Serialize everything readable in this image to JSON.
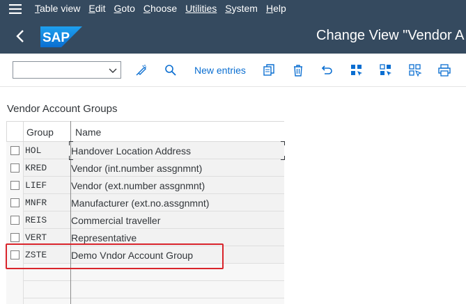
{
  "menu": {
    "items": [
      {
        "label": "Table view",
        "underline": "T",
        "rest": "able view"
      },
      {
        "label": "Edit",
        "underline": "E",
        "rest": "dit"
      },
      {
        "label": "Goto",
        "underline": "G",
        "rest": "oto"
      },
      {
        "label": "Choose",
        "underline": "C",
        "rest": "hoose"
      },
      {
        "label": "Utilities",
        "underline": "",
        "rest": "Utilities"
      },
      {
        "label": "System",
        "underline": "S",
        "rest": "ystem"
      },
      {
        "label": "Help",
        "underline": "H",
        "rest": "elp"
      }
    ]
  },
  "shell": {
    "logo_text": "SAP",
    "title": "Change View \"Vendor A"
  },
  "toolbar": {
    "combo_value": "",
    "new_entries_label": "New entries",
    "icons": [
      "display-change-icon",
      "find-icon",
      "copy-icon",
      "delete-icon",
      "undo-icon",
      "select-all-icon",
      "select-block-icon",
      "deselect-all-icon",
      "print-icon"
    ]
  },
  "section": {
    "title": "Vendor Account Groups"
  },
  "table": {
    "columns": [
      "Group",
      "Name"
    ],
    "rows": [
      {
        "group": "HOL",
        "name": "Handover Location Address"
      },
      {
        "group": "KRED",
        "name": "Vendor (int.number assgnmnt)"
      },
      {
        "group": "LIEF",
        "name": "Vendor (ext.number assgnmnt)"
      },
      {
        "group": "MNFR",
        "name": "Manufacturer (ext.no.assgnmnt)"
      },
      {
        "group": "REIS",
        "name": "Commercial traveller"
      },
      {
        "group": "VERT",
        "name": "Representative"
      },
      {
        "group": "ZSTE",
        "name": "Demo Vndor Account Group"
      }
    ],
    "highlighted_row": "ZSTE"
  },
  "colors": {
    "shell_bg": "#354a5f",
    "link": "#0a6ed1",
    "highlight": "#d9242b",
    "sap_logo": "#0a7fd5"
  }
}
